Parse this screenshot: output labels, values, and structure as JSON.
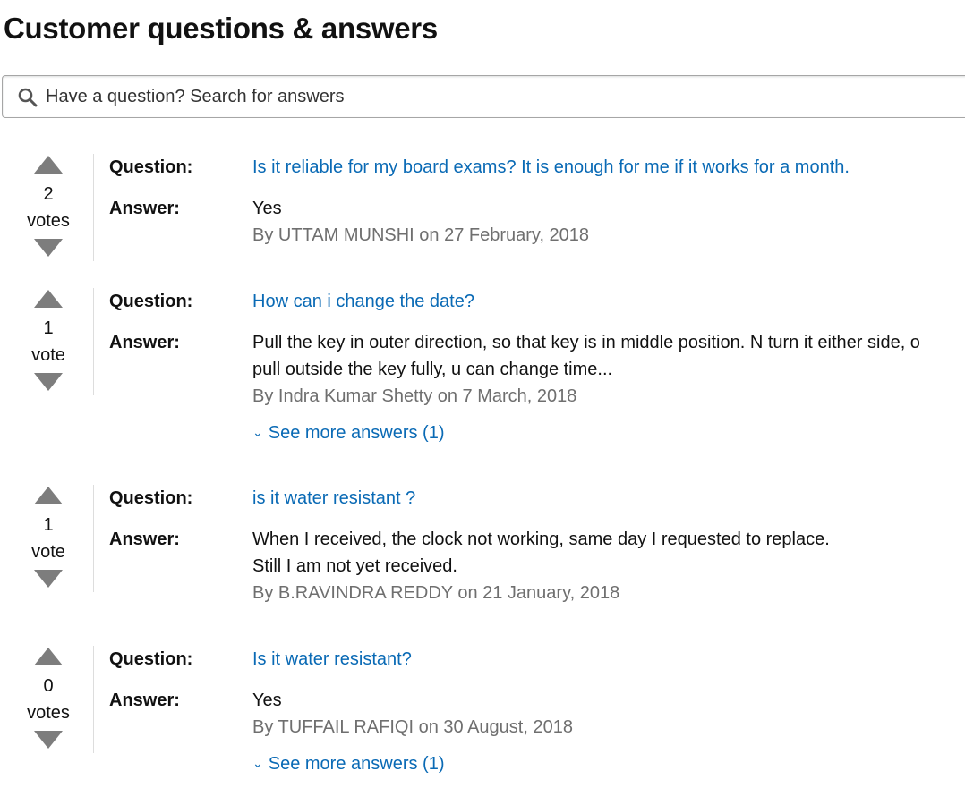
{
  "page_title": "Customer questions & answers",
  "search": {
    "placeholder": "Have a question? Search for answers"
  },
  "labels": {
    "question": "Question:",
    "answer": "Answer:"
  },
  "items": [
    {
      "votes": "2",
      "vote_unit": "votes",
      "question": "Is it reliable for my board exams? It is enough for me if it works for a month.",
      "answer_lines": [
        "Yes"
      ],
      "byline": "By UTTAM MUNSHI on 27 February, 2018",
      "see_more": ""
    },
    {
      "votes": "1",
      "vote_unit": "vote",
      "question": "How can i change the date?",
      "answer_lines": [
        "Pull the key in outer direction, so that key is in middle position. N turn it either side, o",
        "pull outside the key fully, u can change time..."
      ],
      "byline": "By Indra Kumar Shetty on 7 March, 2018",
      "see_more": "See more answers (1)"
    },
    {
      "votes": "1",
      "vote_unit": "vote",
      "question": "is it water resistant ?",
      "answer_lines": [
        "When I received, the clock not working, same day I requested to replace.",
        "Still I am not yet received."
      ],
      "byline": "By B.RAVINDRA REDDY on 21 January, 2018",
      "see_more": ""
    },
    {
      "votes": "0",
      "vote_unit": "votes",
      "question": "Is it water resistant?",
      "answer_lines": [
        "Yes"
      ],
      "byline": "By TUFFAIL RAFIQI on 30 August, 2018",
      "see_more": "See more answers (1)"
    }
  ],
  "icons": {
    "search": "search-icon",
    "vote_up": "triangle-up-icon",
    "vote_down": "triangle-down-icon",
    "expand": "chevron-down-icon"
  },
  "colors": {
    "link": "#0a6ab5",
    "byline": "#6f6f6f",
    "vote_arrow": "#7d7d7d"
  }
}
